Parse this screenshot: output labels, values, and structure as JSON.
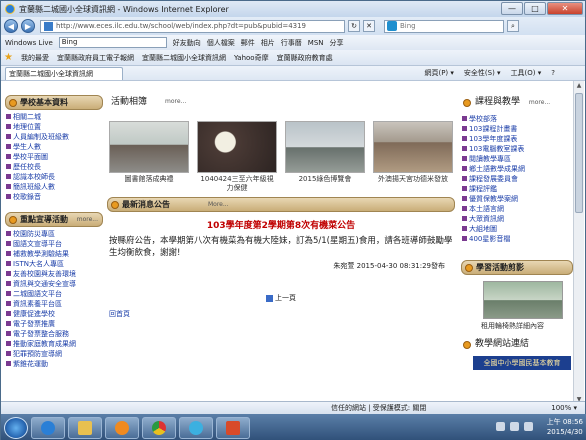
{
  "window": {
    "title": "宜蘭縣二城國小全球資訊網 - Windows Internet Explorer",
    "min": "—",
    "max": "□",
    "close": "✕"
  },
  "address": {
    "url": "http://www.eces.ilc.edu.tw/school/web/index.php?dt=pub&pubid=4319",
    "search_placeholder": "Bing"
  },
  "wl_toolbar": {
    "brand": "Windows Live",
    "input": "Bing",
    "items": [
      "好友動向",
      "個人檔案",
      "郵件",
      "相片",
      "行事曆",
      "MSN",
      "分享"
    ]
  },
  "favorites": {
    "label": "我的最愛",
    "items": [
      "宜蘭縣政府員工電子報網",
      "宜蘭縣二城國小全球資訊網",
      "Yahoo奇摩",
      "宜蘭縣政府教育處"
    ]
  },
  "tab": {
    "label": "宜蘭縣二城國小全球資訊網"
  },
  "commands": [
    "網頁(P) ▾",
    "安全性(S) ▾",
    "工具(O) ▾",
    "?"
  ],
  "left": {
    "title1": "學校基本資料",
    "links1": [
      "相關二城",
      "地理位置",
      "人員編制及班級數",
      "學生人數",
      "學校平面圖",
      "歷任校長",
      "認識本校師長",
      "簡訊班級人數",
      "校歌錄音"
    ],
    "title2": "重點宣導活動",
    "more2": "more...",
    "links2": [
      "校園防災專區",
      "國語文宣導平台",
      "補救教學測驗結果",
      "ISTN大名人專區",
      "友善校園與友善環境",
      "資訊與交通安全宣導",
      "二城國語文平台",
      "資訊素養平台區",
      "健康促進學校",
      "電子發票推廣",
      "電子發票整合服務",
      "推動家庭教育成果網",
      "犯罪預防宣導網",
      "紫錐花運動"
    ]
  },
  "mid": {
    "photo_title": "活動相簿",
    "more": "more...",
    "photos": [
      {
        "caption": "圖書館落成典禮"
      },
      {
        "caption": "1040424三至六年級視力保健"
      },
      {
        "caption": "2015綠色博覽會"
      },
      {
        "caption": "外澳揚天宮功德米發放"
      }
    ],
    "news_title": "最新消息公告",
    "news_more": "More...",
    "announcement_title": "103學年度第2學期第8次有機菜公告",
    "announcement_body": "按縣府公告，本學期第八次有機菜為有機大陸妹，訂為5/1(星期五)食用，請各班導師鼓勵學生均衡飲食，謝謝!",
    "announcement_meta": "朱宛萱  2015-04-30 08:31:29發布",
    "pager": "上一頁",
    "home": "回首頁"
  },
  "right": {
    "title1": "課程與教學",
    "more": "more...",
    "links": [
      "學校部落",
      "103課程計畫書",
      "103學年度課表",
      "103電腦教室課表",
      "閱讀教學專區",
      "鄉土語數學成果網",
      "課程發展委員會",
      "課程評鑑",
      "優質保教學案網",
      "本土語言網",
      "大眾資訊網",
      "大組地圖",
      "400星影音檔"
    ],
    "title2": "學習活動剪影",
    "caption": "租用輪椅熱詳細內容",
    "title3": "教學網站連結",
    "banner": "全國中小學國民基本教育"
  },
  "status": {
    "zone": "信任的網站 | 受保護模式: 關閉",
    "zoom": "100% ▾"
  },
  "taskbar": {
    "time": "上午 08:56",
    "date": "2015/4/30"
  }
}
